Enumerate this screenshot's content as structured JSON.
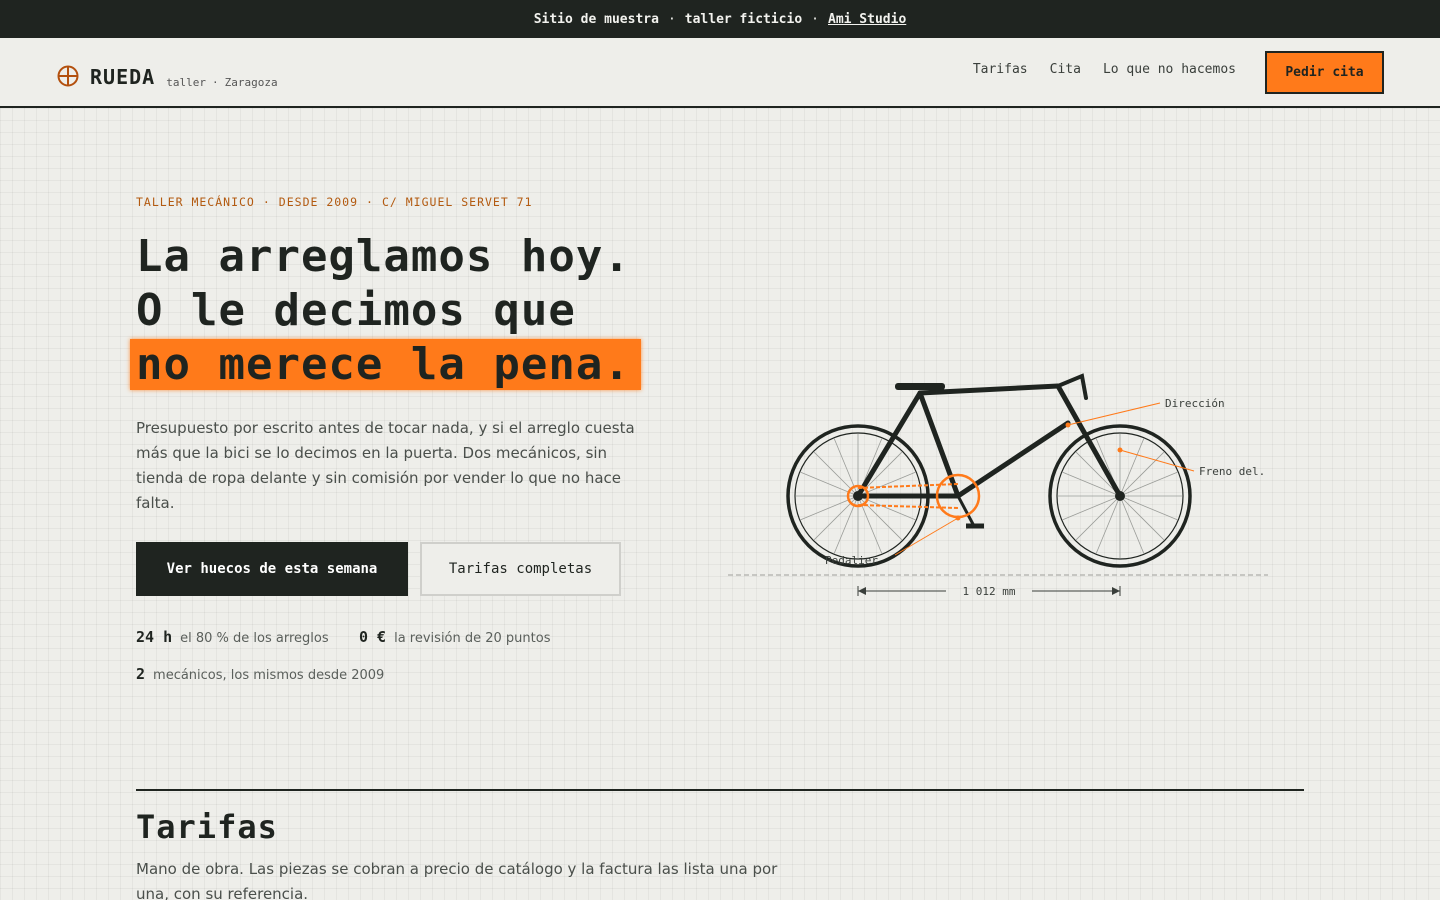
{
  "banner": {
    "part1": "Sitio de muestra",
    "part2": "taller ficticio",
    "link": "Ami Studio",
    "separator": "·"
  },
  "brand": {
    "name": "RUEDA",
    "sub1": "taller",
    "sub2": "Zaragoza",
    "separator": "·",
    "icon": "crosshair-wheel-icon",
    "accent": "#ff7a1a"
  },
  "nav": {
    "items": [
      "Tarifas",
      "Cita",
      "Lo que no hacemos"
    ],
    "cta": "Pedir cita"
  },
  "hero": {
    "eyebrow": [
      "TALLER MECÁNICO",
      "DESDE 2009",
      "C/ MIGUEL SERVET 71"
    ],
    "headline_1": "La arreglamos hoy.",
    "headline_2": "O le decimos que",
    "headline_3": "no merece la pena.",
    "lead": "Presupuesto por escrito antes de tocar nada, y si el arreglo cuesta más que la bici se lo decimos en la puerta. Dos mecánicos, sin tienda de ropa delante y sin comisión por vender lo que no hace falta.",
    "primary_button": "Ver huecos de esta semana",
    "secondary_button": "Tarifas completas"
  },
  "stats": [
    {
      "value": "24 h",
      "label": "el 80 % de los arreglos"
    },
    {
      "value": "0 €",
      "label": "la revisión de 20 puntos"
    },
    {
      "value": "2",
      "label": "mecánicos, los mismos desde 2009"
    }
  ],
  "diagram": {
    "label_direction": "Dirección",
    "label_brake": "Freno del.",
    "label_pedal": "Pedalier",
    "dimension": "1 012 mm",
    "colors": {
      "frame": "#1f2420",
      "accent": "#ff7a1a"
    }
  },
  "section": {
    "title": "Tarifas",
    "lead": "Mano de obra. Las piezas se cobran a precio de catálogo y la factura las lista una por una, con su referencia."
  }
}
